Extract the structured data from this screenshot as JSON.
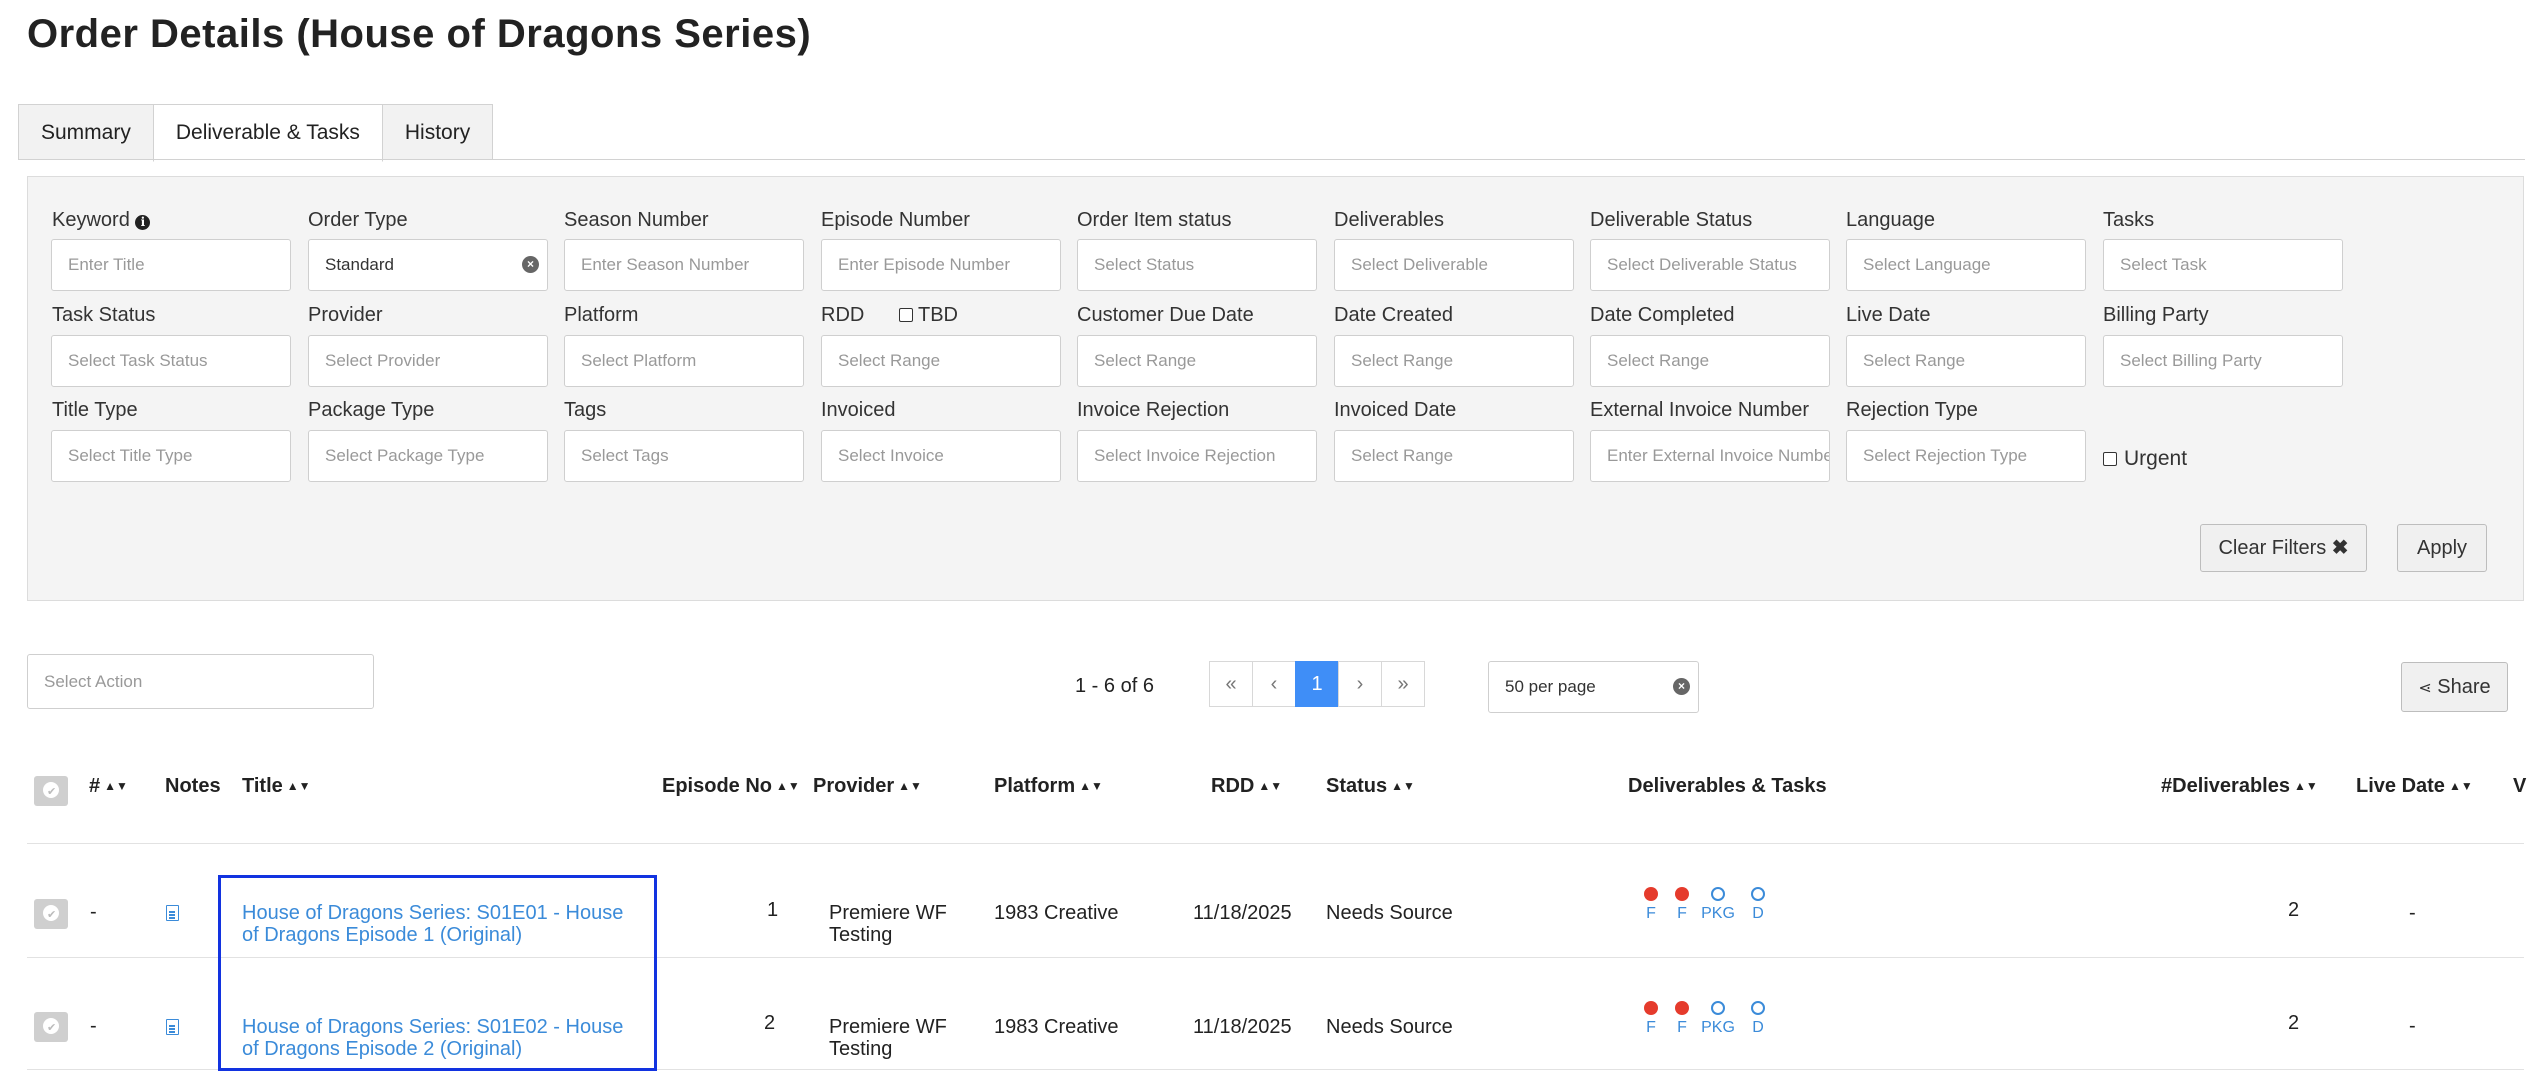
{
  "page": {
    "title": "Order Details (House of Dragons Series)"
  },
  "tabs": [
    {
      "label": "Summary"
    },
    {
      "label": "Deliverable & Tasks"
    },
    {
      "label": "History"
    }
  ],
  "filters": {
    "keyword": {
      "label": "Keyword",
      "placeholder": "Enter Title"
    },
    "order_type": {
      "label": "Order Type",
      "value": "Standard"
    },
    "season_number": {
      "label": "Season Number",
      "placeholder": "Enter Season Number"
    },
    "episode_number": {
      "label": "Episode Number",
      "placeholder": "Enter Episode Number"
    },
    "order_item_status": {
      "label": "Order Item status",
      "placeholder": "Select Status"
    },
    "deliverables": {
      "label": "Deliverables",
      "placeholder": "Select Deliverable"
    },
    "deliverable_status": {
      "label": "Deliverable Status",
      "placeholder": "Select Deliverable Status"
    },
    "language": {
      "label": "Language",
      "placeholder": "Select Language"
    },
    "tasks": {
      "label": "Tasks",
      "placeholder": "Select Task"
    },
    "task_status": {
      "label": "Task Status",
      "placeholder": "Select Task Status"
    },
    "provider": {
      "label": "Provider",
      "placeholder": "Select Provider"
    },
    "platform": {
      "label": "Platform",
      "placeholder": "Select Platform"
    },
    "rdd": {
      "label": "RDD",
      "tbd_label": "TBD",
      "placeholder": "Select Range"
    },
    "customer_due_date": {
      "label": "Customer Due Date",
      "placeholder": "Select Range"
    },
    "date_created": {
      "label": "Date Created",
      "placeholder": "Select Range"
    },
    "date_completed": {
      "label": "Date Completed",
      "placeholder": "Select Range"
    },
    "live_date": {
      "label": "Live Date",
      "placeholder": "Select Range"
    },
    "billing_party": {
      "label": "Billing Party",
      "placeholder": "Select Billing Party"
    },
    "title_type": {
      "label": "Title Type",
      "placeholder": "Select Title Type"
    },
    "package_type": {
      "label": "Package Type",
      "placeholder": "Select Package Type"
    },
    "tags": {
      "label": "Tags",
      "placeholder": "Select Tags"
    },
    "invoiced": {
      "label": "Invoiced",
      "placeholder": "Select Invoice"
    },
    "invoice_rejection": {
      "label": "Invoice Rejection",
      "placeholder": "Select Invoice Rejection"
    },
    "invoiced_date": {
      "label": "Invoiced Date",
      "placeholder": "Select Range"
    },
    "external_invoice_number": {
      "label": "External Invoice Number",
      "placeholder": "Enter External Invoice Number"
    },
    "rejection_type": {
      "label": "Rejection Type",
      "placeholder": "Select Rejection Type"
    },
    "urgent": {
      "label": "Urgent"
    },
    "clear_label": "Clear Filters",
    "apply_label": "Apply"
  },
  "toolbar": {
    "action_placeholder": "Select Action",
    "range_text": "1 - 6 of 6",
    "current_page": "1",
    "per_page": "50 per page",
    "share_label": "Share"
  },
  "table": {
    "headers": {
      "num": "#",
      "notes": "Notes",
      "title": "Title",
      "episode": "Episode No",
      "provider": "Provider",
      "platform": "Platform",
      "rdd": "RDD",
      "status": "Status",
      "deliverables_tasks": "Deliverables & Tasks",
      "num_deliverables": "#Deliverables",
      "live_date": "Live Date",
      "extra": "V"
    },
    "rows": [
      {
        "num": "-",
        "title_line1": "House of Dragons Series: S01E01 - House",
        "title_line2": "of Dragons Episode 1 (Original)",
        "episode": "1",
        "provider_line1": "Premiere WF",
        "provider_line2": "Testing",
        "platform": "1983 Creative",
        "rdd": "11/18/2025",
        "status": "Needs Source",
        "deliverables": [
          "F",
          "F",
          "PKG",
          "D"
        ],
        "num_deliverables": "2",
        "live_date": "-"
      },
      {
        "num": "-",
        "title_line1": "House of Dragons Series: S01E02 - House",
        "title_line2": "of Dragons Episode 2 (Original)",
        "episode": "2",
        "provider_line1": "Premiere WF",
        "provider_line2": "Testing",
        "platform": "1983 Creative",
        "rdd": "11/18/2025",
        "status": "Needs Source",
        "deliverables": [
          "F",
          "F",
          "PKG",
          "D"
        ],
        "num_deliverables": "2",
        "live_date": "-"
      }
    ]
  },
  "colors": {
    "accent": "#3f8ef7",
    "link": "#3b8bd9",
    "dot_red": "#e53b2c",
    "highlight": "#1233e0"
  }
}
